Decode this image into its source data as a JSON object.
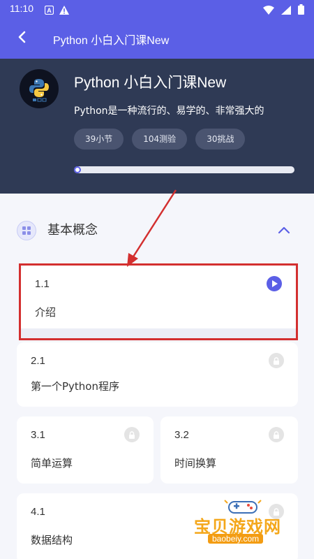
{
  "status_bar": {
    "time": "11:10",
    "left_icons": [
      "a-icon",
      "warning-icon"
    ],
    "right_icons": [
      "wifi-icon",
      "signal-icon",
      "battery-icon"
    ]
  },
  "app_bar": {
    "title": "Python 小白入门课New",
    "back_icon": "back-arrow-icon"
  },
  "course": {
    "title": "Python 小白入门课New",
    "description": "Python是一种流行的、易学的、非常强大的",
    "stats": [
      "39小节",
      "104测验",
      "30挑战"
    ],
    "progress": 0.0
  },
  "section": {
    "title": "基本概念",
    "icon": "grid-icon",
    "collapse_icon": "chevron-up-icon"
  },
  "lessons": [
    {
      "num": "1.1",
      "name": "介绍",
      "status": "play"
    },
    {
      "num": "2.1",
      "name": "第一个Python程序",
      "status": "locked"
    },
    {
      "num": "3.1",
      "name": "简单运算",
      "status": "locked"
    },
    {
      "num": "3.2",
      "name": "时间换算",
      "status": "locked"
    },
    {
      "num": "4.1",
      "name": "数据结构",
      "status": "locked"
    }
  ],
  "watermark": {
    "text": "宝贝游戏网",
    "url": "baobeiy.com"
  },
  "colors": {
    "accent": "#5b5fe6",
    "header_bg": "#2f3a55",
    "annotation": "#d32f2f"
  }
}
